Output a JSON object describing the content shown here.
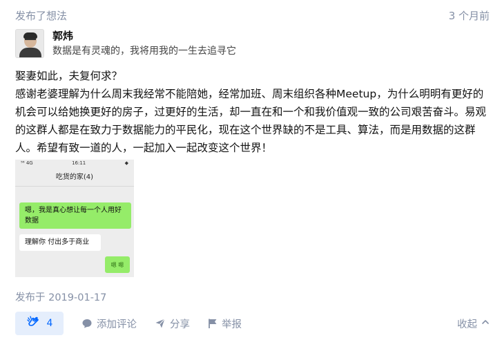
{
  "header": {
    "action": "发布了想法",
    "time_ago": "3 个月前"
  },
  "author": {
    "name": "郭炜",
    "bio": "数据是有灵魂的，我将用我的一生去追寻它"
  },
  "post": {
    "paragraphs": [
      "娶妻如此，夫复何求？",
      "感谢老婆理解为什么周末我经常不能陪她，经常加班、周末组织各种Meetup，为什么明明有更好的机会可以给她换更好的房子，过更好的生活，却一直在和一个和我价值观一致的公司艰苦奋斗。易观的这群人都是在致力于数据能力的平民化，现在这个世界缺的不是工具、算法，而是用数据的这群人。希望有致一道的人，一起加入一起改变这个世界！"
    ],
    "image": {
      "status_left": "⁵⁶ 4G",
      "status_time": "16:11",
      "status_right": "◆",
      "chat_title": "吃货的家(4)",
      "msg1": "嗯，我是真心想让每一个人用好数据",
      "msg2": "理解你 付出多于商业",
      "msg3": "嗯 嗯"
    },
    "publish_date": "发布于 2019-01-17"
  },
  "actions": {
    "like_count": "4",
    "comment": "添加评论",
    "share": "分享",
    "report": "举报",
    "collapse": "收起"
  },
  "colors": {
    "accent": "#0066ff",
    "like_bg": "#e5eefc",
    "muted": "#8590a6",
    "chat_green": "#95ec69"
  }
}
